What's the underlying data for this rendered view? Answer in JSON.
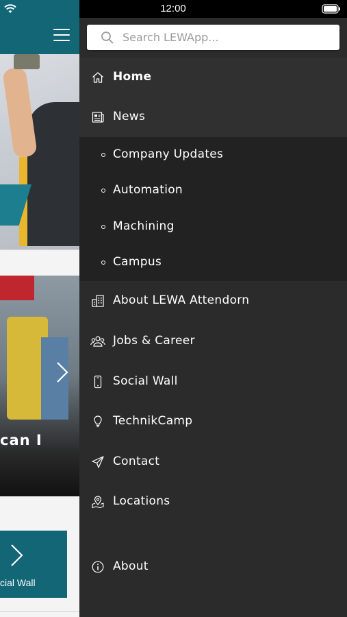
{
  "status_bar": {
    "time": "12:00"
  },
  "search": {
    "placeholder": "Search LEWApp..."
  },
  "menu": {
    "home": "Home",
    "news": "News",
    "news_sub": [
      "Company Updates",
      "Automation",
      "Machining",
      "Campus"
    ],
    "about_lewa": "About LEWA Attendorn",
    "jobs": "Jobs & Career",
    "social": "Social Wall",
    "technik": "TechnikCamp",
    "contact": "Contact",
    "locations": "Locations",
    "about": "About"
  },
  "background": {
    "slider_caption": "can I",
    "tile_label": "cial Wall"
  },
  "colors": {
    "brand_teal": "#126676",
    "drawer_bg": "#2b2b2b",
    "submenu_bg": "#222222"
  }
}
